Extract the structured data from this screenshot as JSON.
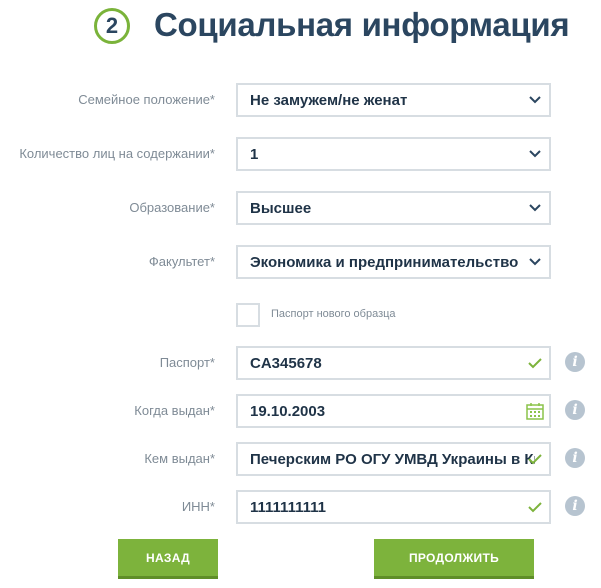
{
  "header": {
    "step": "2",
    "title": "Социальная информация"
  },
  "form": {
    "marital_status": {
      "label": "Семейное положение*",
      "value": "Не замужем/не женат"
    },
    "dependents": {
      "label": "Количество лиц на содержании*",
      "value": "1"
    },
    "education": {
      "label": "Образование*",
      "value": "Высшее"
    },
    "faculty": {
      "label": "Факультет*",
      "value": "Экономика и предпринимательство"
    },
    "new_passport": {
      "label": "Паспорт нового образца",
      "checked": false
    },
    "passport": {
      "label": "Паспорт*",
      "value": "CA345678"
    },
    "issued_date": {
      "label": "Когда выдан*",
      "value": "19.10.2003"
    },
    "issued_by": {
      "label": "Кем выдан*",
      "value": "Печерским РО ОГУ УМВД Украины в Киеве"
    },
    "inn": {
      "label": "ИНН*",
      "value": "1111111111"
    }
  },
  "buttons": {
    "back": "НАЗАД",
    "continue": "ПРОДОЛЖИТЬ"
  },
  "icons": {
    "dropdown": "chevron-down-icon",
    "valid": "check-icon",
    "date": "calendar-icon",
    "info": "info-icon"
  },
  "colors": {
    "accent": "#7db33c",
    "title": "#2b4660",
    "border": "#d7dde2",
    "label": "#7f8b96",
    "info": "#b7c4d0"
  }
}
